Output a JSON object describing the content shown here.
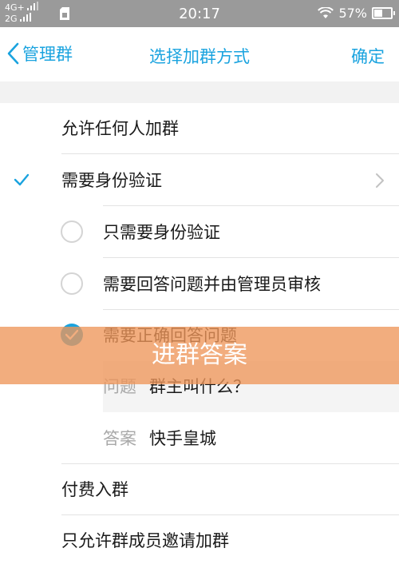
{
  "status_bar": {
    "network_top": "4G+",
    "network_bottom": "2G",
    "time": "20:17",
    "battery": "57%",
    "battery_level": 0.57
  },
  "nav": {
    "back_label": "管理群",
    "title": "选择加群方式",
    "confirm_label": "确定"
  },
  "options": {
    "allow_anyone": "允许任何人加群",
    "need_verification": "需要身份验证",
    "sub_only_verification": "只需要身份验证",
    "sub_answer_admin_review": "需要回答问题并由管理员审核",
    "sub_correct_answer": "需要正确回答问题",
    "question_key": "问题",
    "question_value": "群主叫什么？",
    "answer_key": "答案",
    "answer_value": "快手皇城",
    "paid_join": "付费入群",
    "invite_only": "只允许群成员邀请加群"
  },
  "overlay": {
    "caption": "进群答案"
  },
  "colors": {
    "accent": "#1aa3df",
    "overlay": "#ee965a"
  }
}
